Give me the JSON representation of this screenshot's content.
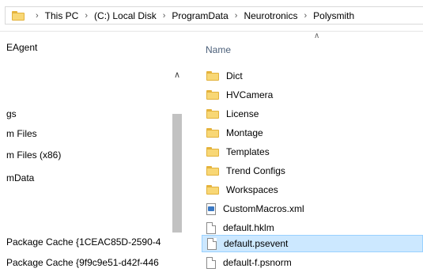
{
  "address_bar": {
    "crumbs": [
      "This PC",
      "(C:) Local Disk",
      "ProgramData",
      "Neurotronics",
      "Polysmith"
    ]
  },
  "nav": {
    "items": [
      "EAgent",
      "gs",
      "m Files",
      "m Files (x86)",
      "mData",
      "Package Cache {1CEAC85D-2590-4",
      "Package Cache {9f9c9e51-d42f-446"
    ]
  },
  "file_list": {
    "column_header": "Name",
    "items": [
      {
        "name": "Dict",
        "type": "folder"
      },
      {
        "name": "HVCamera",
        "type": "folder"
      },
      {
        "name": "License",
        "type": "folder"
      },
      {
        "name": "Montage",
        "type": "folder"
      },
      {
        "name": "Templates",
        "type": "folder"
      },
      {
        "name": "Trend Configs",
        "type": "folder"
      },
      {
        "name": "Workspaces",
        "type": "folder"
      },
      {
        "name": "CustomMacros.xml",
        "type": "xml-file"
      },
      {
        "name": "default.hklm",
        "type": "file"
      },
      {
        "name": "default.psevent",
        "type": "file",
        "selected": true
      },
      {
        "name": "default-f.psnorm",
        "type": "file"
      }
    ]
  }
}
